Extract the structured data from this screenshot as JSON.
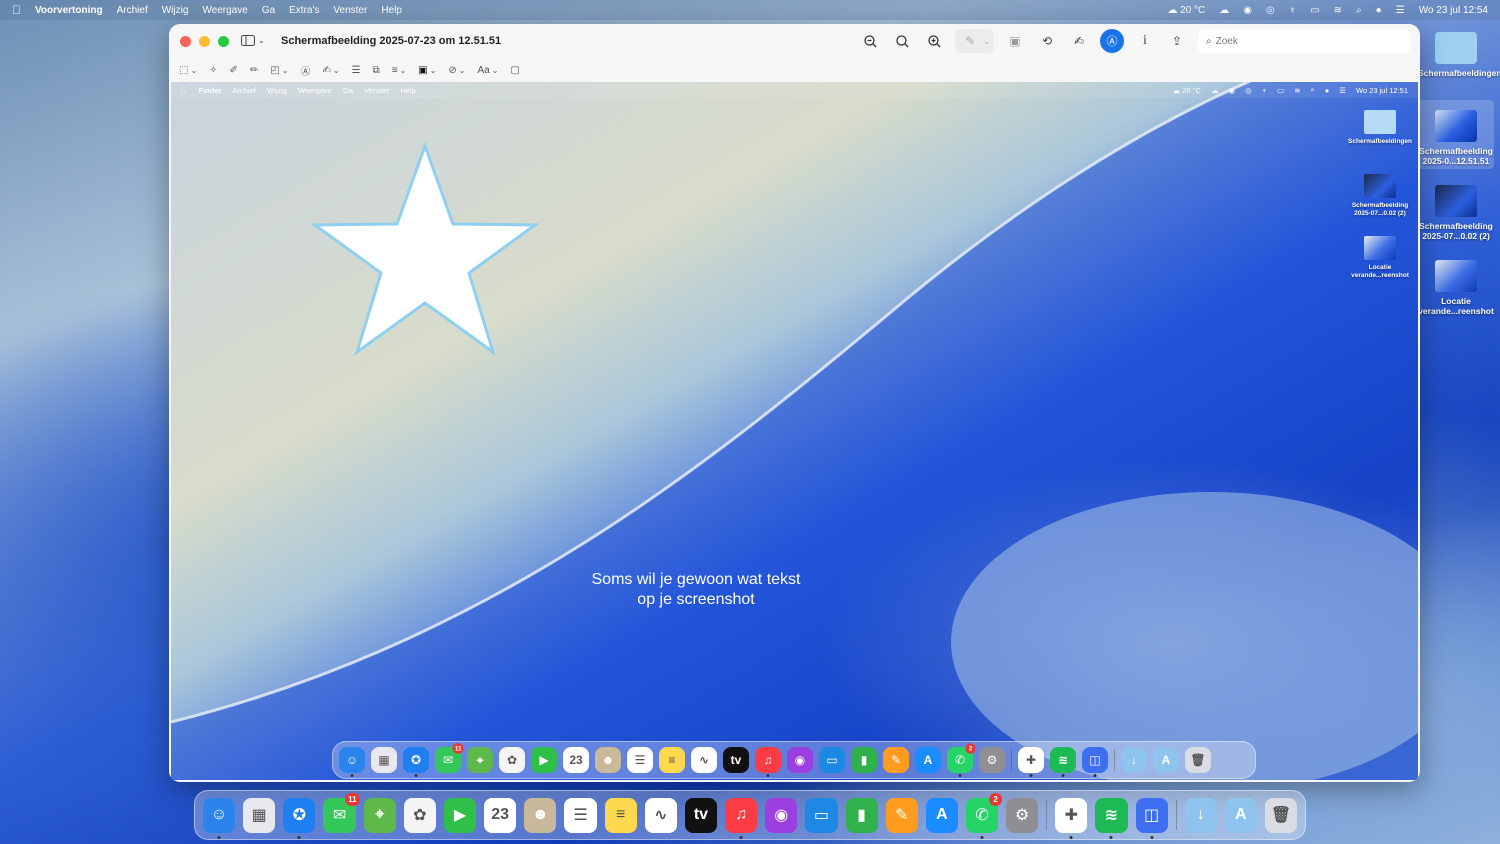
{
  "menubar": {
    "app_name": "Voorvertoning",
    "items": [
      "Archief",
      "Wijzig",
      "Weergave",
      "Ga",
      "Extra's",
      "Venster",
      "Help"
    ],
    "weather": "20 °C",
    "datetime": "Wo 23 jul 12:54"
  },
  "desktop_icons": [
    {
      "label": "Schermafbeeldingen"
    },
    {
      "label": "Schermafbeelding 2025-0...12.51.51"
    },
    {
      "label": "Schermafbeelding 2025-07...0.02 (2)"
    },
    {
      "label": "Locatie verande...reenshot"
    }
  ],
  "window": {
    "title": "Schermafbeelding 2025-07-23 om 12.51.51",
    "search_placeholder": "Zoek",
    "info_label": "i"
  },
  "document": {
    "menubar": {
      "app_name": "Finder",
      "items": [
        "Archief",
        "Wijzig",
        "Weergave",
        "Ga",
        "Venster",
        "Help"
      ],
      "weather": "20 °C",
      "datetime": "Wo 23 jul 12:51"
    },
    "desktop_icons": [
      {
        "label": "Schermafbeeldingen"
      },
      {
        "label": "Schermafbeelding 2025-07...0.02 (2)"
      },
      {
        "label": "Locatie verande...reenshot"
      }
    ],
    "annotation_line1": "Soms wil je gewoon wat tekst",
    "annotation_line2": "op je screenshot"
  },
  "dock_apps": [
    {
      "name": "finder-icon",
      "color": "#2b84ec",
      "glyph": "☺",
      "running": true
    },
    {
      "name": "launchpad-icon",
      "color": "#e8e8ee",
      "glyph": "▦",
      "running": false
    },
    {
      "name": "safari-icon",
      "color": "#1f7ef0",
      "glyph": "✪",
      "running": true
    },
    {
      "name": "messages-icon",
      "color": "#34c759",
      "glyph": "✉",
      "running": false,
      "badge": "11"
    },
    {
      "name": "maps-icon",
      "color": "#5fb84a",
      "glyph": "⌖",
      "running": false
    },
    {
      "name": "photos-icon",
      "color": "#f4f4f4",
      "glyph": "✿",
      "running": false
    },
    {
      "name": "facetime-icon",
      "color": "#30c048",
      "glyph": "▶",
      "running": false
    },
    {
      "name": "calendar-icon",
      "color": "#ffffff",
      "glyph": "23",
      "running": false
    },
    {
      "name": "contacts-icon",
      "color": "#c9b89a",
      "glyph": "☻",
      "running": false
    },
    {
      "name": "reminders-icon",
      "color": "#ffffff",
      "glyph": "☰",
      "running": false
    },
    {
      "name": "notes-icon",
      "color": "#ffd84d",
      "glyph": "≡",
      "running": false
    },
    {
      "name": "freeform-icon",
      "color": "#ffffff",
      "glyph": "∿",
      "running": false
    },
    {
      "name": "appletv-icon",
      "color": "#111111",
      "glyph": "tv",
      "running": false
    },
    {
      "name": "music-icon",
      "color": "#fc3c44",
      "glyph": "♫",
      "running": true
    },
    {
      "name": "podcasts-icon",
      "color": "#9b3fe0",
      "glyph": "◉",
      "running": false
    },
    {
      "name": "keynote-icon",
      "color": "#1e88e5",
      "glyph": "▭",
      "running": false
    },
    {
      "name": "numbers-icon",
      "color": "#2fb24c",
      "glyph": "▮",
      "running": false
    },
    {
      "name": "pages-icon",
      "color": "#ff9b1f",
      "glyph": "✎",
      "running": false
    },
    {
      "name": "appstore-icon",
      "color": "#1a8cff",
      "glyph": "A",
      "running": false
    },
    {
      "name": "whatsapp-icon",
      "color": "#25d366",
      "glyph": "✆",
      "running": true,
      "badge": "2"
    },
    {
      "name": "system-settings-icon",
      "color": "#8e8e93",
      "glyph": "⚙",
      "running": false
    },
    {
      "name": "sep",
      "sep": true
    },
    {
      "name": "slack-icon",
      "color": "#ffffff",
      "glyph": "✚",
      "running": true
    },
    {
      "name": "spotify-icon",
      "color": "#1db954",
      "glyph": "≋",
      "running": true
    },
    {
      "name": "preview-icon",
      "color": "#3d6ff0",
      "glyph": "◫",
      "running": true
    },
    {
      "name": "sep",
      "sep": true
    },
    {
      "name": "downloads-folder-icon",
      "color": "#8ec3ee",
      "glyph": "↓",
      "running": false
    },
    {
      "name": "applications-folder-icon",
      "color": "#8ec3ee",
      "glyph": "A",
      "running": false
    },
    {
      "name": "trash-icon",
      "color": "#d9dde3",
      "glyph": "🗑",
      "running": false
    }
  ],
  "inner_dock_badge_messages": "11"
}
